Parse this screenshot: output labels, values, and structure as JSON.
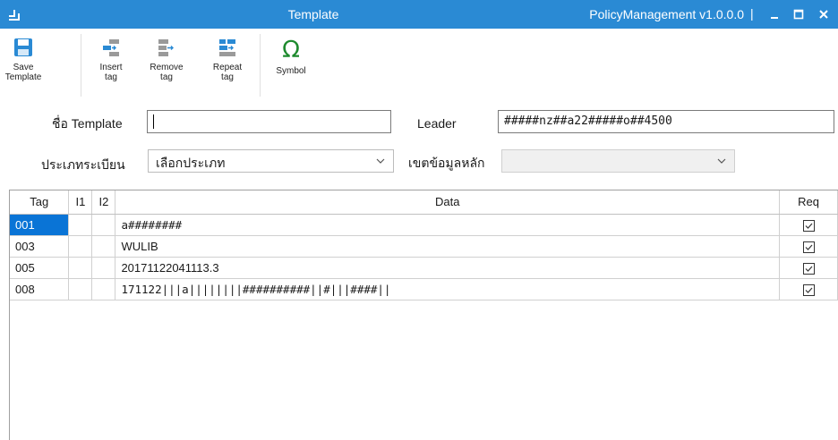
{
  "window": {
    "title": "Template",
    "app_version": "PolicyManagement v1.0.0.0",
    "separator": "|",
    "accent_color": "#2a8ad4"
  },
  "toolbar": {
    "buttons": [
      {
        "label_line1": "Save",
        "label_line2": "Template",
        "icon": "save-icon"
      },
      {
        "label_line1": "Insert",
        "label_line2": "tag",
        "icon": "insert-tag-icon"
      },
      {
        "label_line1": "Remove",
        "label_line2": "tag",
        "icon": "remove-tag-icon"
      },
      {
        "label_line1": "Repeat",
        "label_line2": "tag",
        "icon": "repeat-tag-icon"
      },
      {
        "label_line1": "Symbol",
        "label_line2": "",
        "icon": "omega-icon"
      }
    ]
  },
  "form": {
    "template_name_label": "ชื่อ Template",
    "template_name_value": "",
    "leader_label": "Leader",
    "leader_value": "#####nz##a22#####o##4500",
    "record_type_label": "ประเภทระเบียน",
    "record_type_value": "เลือกประเภท",
    "main_data_label": "เขตข้อมูลหลัก",
    "main_data_value": ""
  },
  "grid": {
    "columns": [
      "Tag",
      "I1",
      "I2",
      "Data",
      "Req"
    ],
    "rows": [
      {
        "tag": "001",
        "i1": "",
        "i2": "",
        "data": "a########",
        "req": true,
        "selected": true
      },
      {
        "tag": "003",
        "i1": "",
        "i2": "",
        "data": "WULIB",
        "req": true,
        "selected": false
      },
      {
        "tag": "005",
        "i1": "",
        "i2": "",
        "data": "20171122041113.3",
        "req": true,
        "selected": false
      },
      {
        "tag": "008",
        "i1": "",
        "i2": "",
        "data": "171122|||a||||||||##########||#|||####||",
        "req": true,
        "selected": false
      }
    ]
  }
}
